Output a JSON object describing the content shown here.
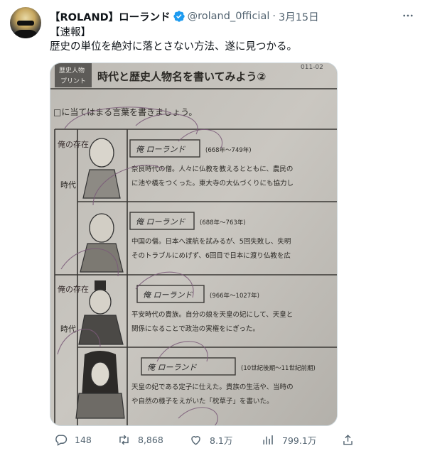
{
  "tweet": {
    "author_name": "【ROLAND】ローランド",
    "handle": "@roland_0fficial",
    "separator": "·",
    "date": "3月15日",
    "lines": [
      "【速報】",
      "歴史の単位を絶対に落とさない方法、遂に見つかる。"
    ]
  },
  "photo": {
    "corner_tag": [
      "歴史人物",
      "プリント"
    ],
    "title": "時代と歴史人物名を書いてみよう②",
    "code": "011-02",
    "instruction": "□に当てはまる言葉を書きましょう。",
    "era_written": "俺の存在",
    "era_suffix": "時代",
    "name_written": "俺 ローランド",
    "entries": [
      {
        "years": "(668年～749年)",
        "desc": [
          "奈良時代の僧。人々に仏教を教えるとともに、農民の",
          "に池や橋をつくった。東大寺の大仏づくりにも協力し"
        ]
      },
      {
        "years": "(688年～763年)",
        "desc": [
          "中国の僧。日本へ渡航を試みるが、5回失敗し、失明",
          "そのトラブルにめげず、6回目で日本に渡り仏教を広"
        ]
      },
      {
        "years": "(966年～1027年)",
        "desc": [
          "平安時代の貴族。自分の娘を天皇の妃にして、天皇と",
          "関係になることで政治の実権をにぎった。"
        ]
      },
      {
        "years": "(10世紀後期～11世紀前期)",
        "desc": [
          "天皇の妃である定子に仕えた。貴族の生活や、当時の",
          "や自然の様子をえがいた「枕草子」を書いた。"
        ]
      }
    ]
  },
  "actions": {
    "reply_count": "148",
    "retweet_count": "8,868",
    "like_count": "8.1万",
    "view_count": "799.1万"
  },
  "colors": {
    "verified_blue": "#1d9bf0",
    "secondary_text": "#536471",
    "pen_ink": "#7a5a78"
  },
  "icons": [
    "verified-badge-icon",
    "more-icon",
    "reply-icon",
    "retweet-icon",
    "like-icon",
    "views-icon",
    "share-icon"
  ]
}
